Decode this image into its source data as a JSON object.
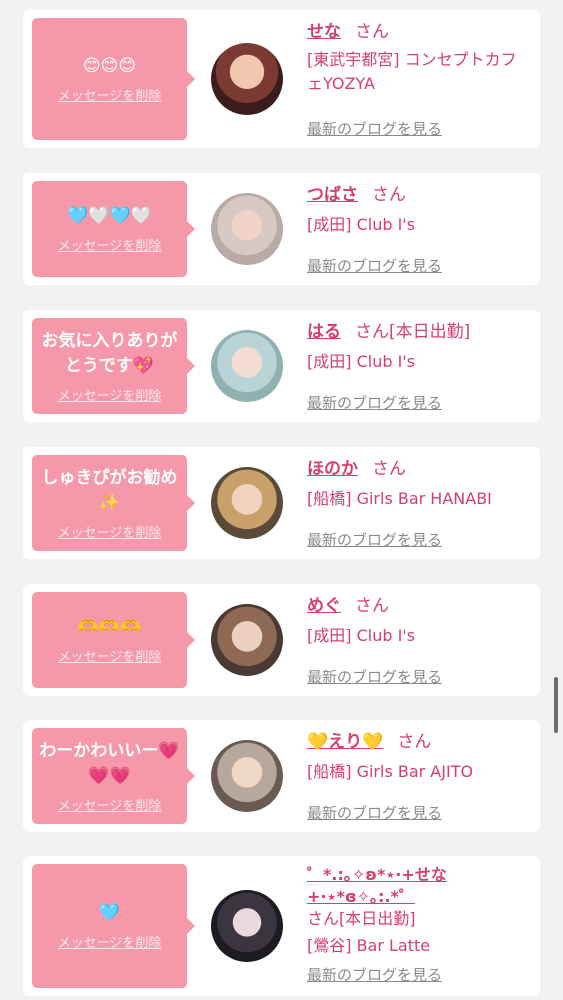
{
  "delete_label": "メッセージを削除",
  "blog_label": "最新のブログを見る",
  "san_label": "さん",
  "entries": [
    {
      "message": "😊😊😊",
      "name": "せな",
      "status": "",
      "shop": "[東武宇都宮] コンセプトカフェYOZYA"
    },
    {
      "message": "🩵🤍🩵🤍",
      "name": "つばさ",
      "status": "",
      "shop": "[成田] Club I's"
    },
    {
      "message": "お気に入りありがとうです💖",
      "name": "はる",
      "status": "[本日出勤]",
      "shop": "[成田] Club I's"
    },
    {
      "message": "しゅきぴがお勧め✨",
      "name": "ほのか",
      "status": "",
      "shop": "[船橋] Girls Bar HANABI"
    },
    {
      "message": "🫶🫶🫶",
      "name": "めぐ",
      "status": "",
      "shop": "[成田] Club I's"
    },
    {
      "message": "わーかわいいー💗💗💗",
      "name": "💛えり💛",
      "status": "",
      "shop": "[船橋] Girls Bar AJITO"
    },
    {
      "message": "🩵",
      "name": "゜*.:｡✧ʚ*⋆·+せな+·⋆*ɞ✧｡:.*゜",
      "status": "[本日出勤]",
      "shop": "[鶯谷] Bar Latte"
    }
  ],
  "colors": {
    "accent": "#d63f6c",
    "bubble": "#f598a9",
    "background": "#f2f2f4"
  }
}
